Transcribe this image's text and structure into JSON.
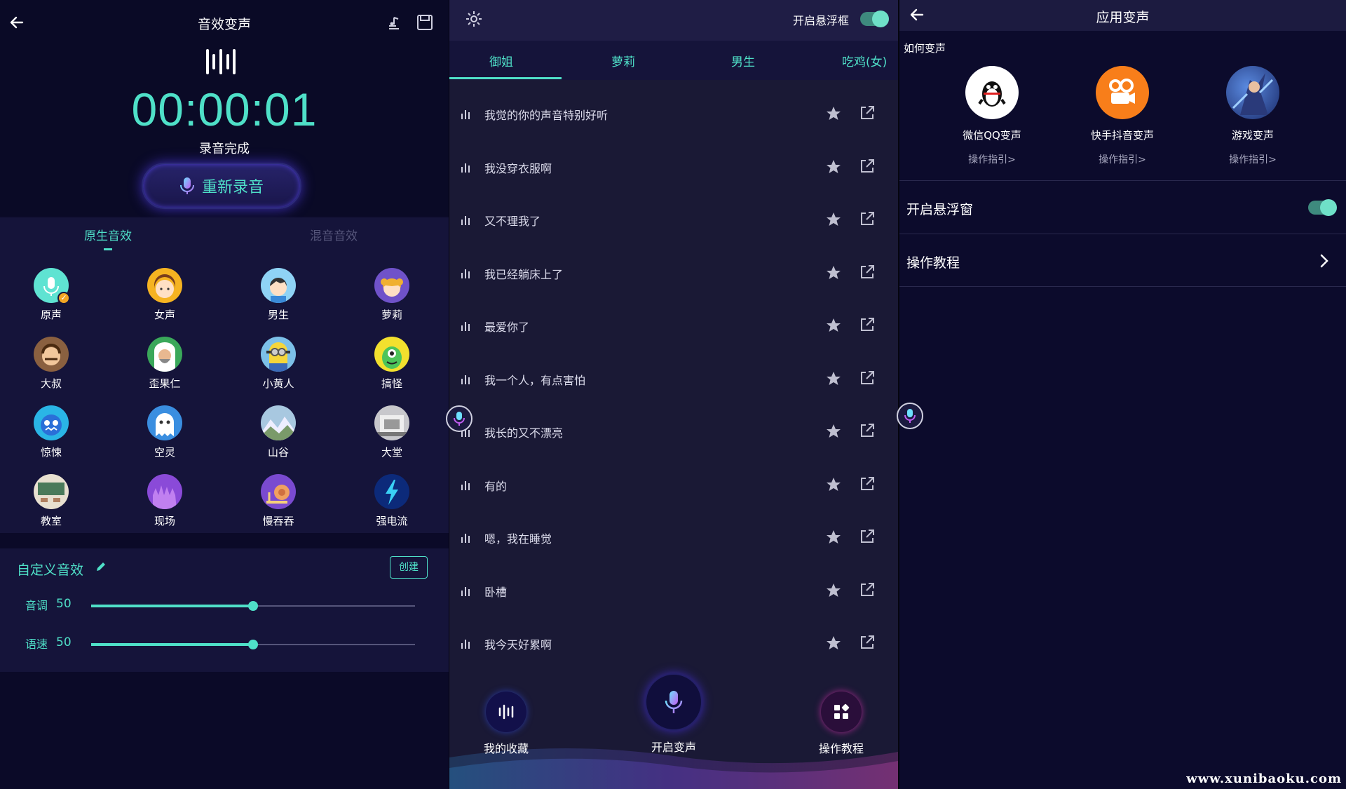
{
  "panel1": {
    "title": "音效变声",
    "timer": "00:00:01",
    "status": "录音完成",
    "rerecord_label": "重新录音",
    "tabs": [
      "原生音效",
      "混音音效"
    ],
    "effects": [
      {
        "label": "原声",
        "icon": "mic-icon"
      },
      {
        "label": "女声",
        "icon": "girl-avatar-icon"
      },
      {
        "label": "男生",
        "icon": "boy-avatar-icon"
      },
      {
        "label": "萝莉",
        "icon": "loli-avatar-icon"
      },
      {
        "label": "大叔",
        "icon": "uncle-avatar-icon"
      },
      {
        "label": "歪果仁",
        "icon": "foreigner-avatar-icon"
      },
      {
        "label": "小黄人",
        "icon": "minion-avatar-icon"
      },
      {
        "label": "搞怪",
        "icon": "monster-avatar-icon"
      },
      {
        "label": "惊悚",
        "icon": "horror-avatar-icon"
      },
      {
        "label": "空灵",
        "icon": "ghost-avatar-icon"
      },
      {
        "label": "山谷",
        "icon": "valley-icon"
      },
      {
        "label": "大堂",
        "icon": "hall-icon"
      },
      {
        "label": "教室",
        "icon": "classroom-icon"
      },
      {
        "label": "现场",
        "icon": "live-icon"
      },
      {
        "label": "慢吞吞",
        "icon": "snail-icon"
      },
      {
        "label": "强电流",
        "icon": "lightning-icon"
      }
    ],
    "custom": {
      "title": "自定义音效",
      "create_label": "创建",
      "pitch_label": "音调",
      "pitch_value": "50",
      "pitch_fraction": 0.5,
      "speed_label": "语速",
      "speed_value": "50",
      "speed_fraction": 0.5
    }
  },
  "panel2": {
    "float_label": "开启悬浮框",
    "float_enabled": true,
    "categories": [
      "御姐",
      "萝莉",
      "男生",
      "吃鸡(女)"
    ],
    "active_category": "御姐",
    "phrases": [
      "我觉的你的声音特别好听",
      "我没穿衣服啊",
      "又不理我了",
      "我已经躺床上了",
      "最爱你了",
      "我一个人，有点害怕",
      "我长的又不漂亮",
      "有的",
      "嗯，我在睡觉",
      "卧槽",
      "我今天好累啊"
    ],
    "bottom": {
      "favorites_label": "我的收藏",
      "start_label": "开启变声",
      "tutorial_label": "操作教程"
    }
  },
  "panel3": {
    "title": "应用变声",
    "how_label": "如何变声",
    "apps": [
      {
        "name": "微信QQ变声",
        "guide": "操作指引>",
        "icon": "qq-penguin-icon"
      },
      {
        "name": "快手抖音变声",
        "guide": "操作指引>",
        "icon": "kuaishou-icon"
      },
      {
        "name": "游戏变声",
        "guide": "操作指引>",
        "icon": "game-avatar-icon"
      }
    ],
    "float_window_label": "开启悬浮窗",
    "float_window_enabled": true,
    "tutorial_label": "操作教程"
  },
  "watermark": "www.xunibaoku.com",
  "colors": {
    "accent": "#4fe0c8",
    "background": "#0b0a28",
    "card": "#15143a"
  }
}
